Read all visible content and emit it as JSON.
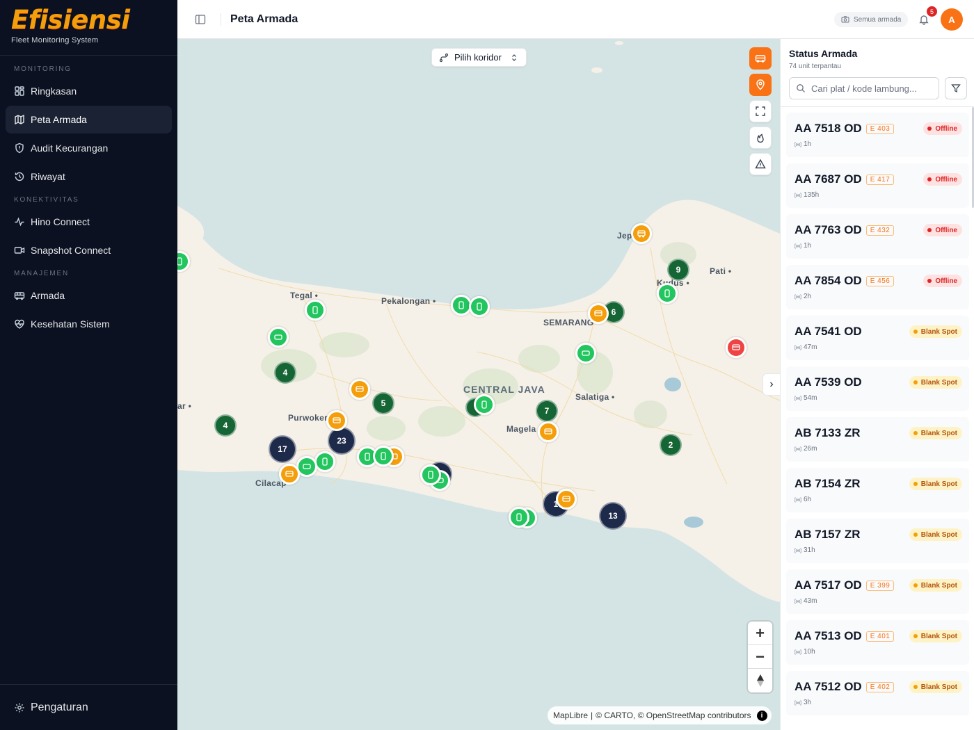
{
  "brand": {
    "logo": "Efisiensi",
    "subtitle": "Fleet Monitoring System"
  },
  "sidebar": {
    "sections": [
      {
        "title": "MONITORING"
      },
      {
        "title": "KONEKTIVITAS"
      },
      {
        "title": "MANAJEMEN"
      }
    ],
    "items": [
      {
        "label": "Ringkasan",
        "icon": "grid-icon"
      },
      {
        "label": "Peta Armada",
        "icon": "map-icon",
        "active": true
      },
      {
        "label": "Audit Kecurangan",
        "icon": "shield-icon"
      },
      {
        "label": "Riwayat",
        "icon": "history-icon"
      },
      {
        "label": "Hino Connect",
        "icon": "activity-icon"
      },
      {
        "label": "Snapshot Connect",
        "icon": "video-icon"
      },
      {
        "label": "Armada",
        "icon": "bus-icon"
      },
      {
        "label": "Kesehatan Sistem",
        "icon": "heart-pulse-icon"
      }
    ],
    "settings_label": "Pengaturan"
  },
  "header": {
    "title": "Peta Armada",
    "fleet_chip": "Semua armada",
    "notification_count": "5",
    "avatar_initial": "A"
  },
  "map": {
    "corridor_select": "Pilih koridor",
    "attribution": {
      "maplibre": "MapLibre",
      "carto": "© CARTO",
      "osm": "© OpenStreetMap",
      "contributors": "contributors",
      "info": "i"
    },
    "cities": {
      "tegal": "Tegal",
      "pekalongan": "Pekalongan",
      "semarang": "SEMARANG",
      "jepara": "Jep",
      "kudus": "Kudus",
      "pati": "Pati",
      "central_java": "CENTRAL JAVA",
      "salatiga": "Salatiga",
      "purwokerto": "Purwoker",
      "magelang": "Magela",
      "cilacap": "Cilacap",
      "ar": "ar"
    },
    "clusters": [
      "9",
      "6",
      "4",
      "5",
      "7",
      "4",
      "17",
      "23",
      "2",
      "1",
      "13"
    ],
    "zoom_in": "+",
    "zoom_out": "−"
  },
  "panel": {
    "title": "Status Armada",
    "subtitle": "74 unit terpantau",
    "search_placeholder": "Cari plat / kode lambung...",
    "vehicles": [
      {
        "plate": "AA 7518 OD",
        "code": "E 403",
        "status": "Offline",
        "age": "1h"
      },
      {
        "plate": "AA 7687 OD",
        "code": "E 417",
        "status": "Offline",
        "age": "135h"
      },
      {
        "plate": "AA 7763 OD",
        "code": "E 432",
        "status": "Offline",
        "age": "1h"
      },
      {
        "plate": "AA 7854 OD",
        "code": "E 456",
        "status": "Offline",
        "age": "2h"
      },
      {
        "plate": "AA 7541 OD",
        "code": "",
        "status": "Blank Spot",
        "age": "47m"
      },
      {
        "plate": "AA 7539 OD",
        "code": "",
        "status": "Blank Spot",
        "age": "54m"
      },
      {
        "plate": "AB 7133 ZR",
        "code": "",
        "status": "Blank Spot",
        "age": "26m"
      },
      {
        "plate": "AB 7154 ZR",
        "code": "",
        "status": "Blank Spot",
        "age": "6h"
      },
      {
        "plate": "AB 7157 ZR",
        "code": "",
        "status": "Blank Spot",
        "age": "31h"
      },
      {
        "plate": "AA 7517 OD",
        "code": "E 399",
        "status": "Blank Spot",
        "age": "43m"
      },
      {
        "plate": "AA 7513 OD",
        "code": "E 401",
        "status": "Blank Spot",
        "age": "10h"
      },
      {
        "plate": "AA 7512 OD",
        "code": "E 402",
        "status": "Blank Spot",
        "age": "3h"
      }
    ]
  },
  "colors": {
    "brand": "#f59e0b",
    "accent": "#f97316",
    "sidebar_bg": "#0b1120",
    "online": "#22c55e",
    "offline": "#dc2626",
    "blank_spot": "#f59e0b",
    "cluster_green": "#166534",
    "cluster_navy": "#1e2a4a"
  }
}
